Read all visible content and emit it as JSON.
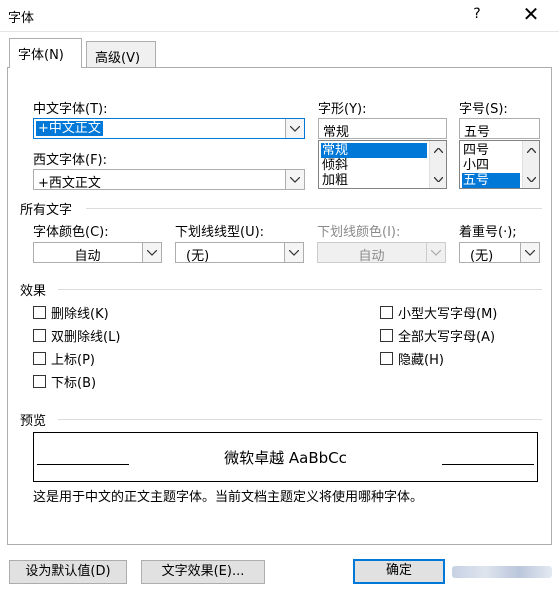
{
  "window": {
    "title": "字体",
    "help": "?",
    "close": "✕"
  },
  "tabs": [
    {
      "label": "字体(N)",
      "active": true
    },
    {
      "label": "高级(V)",
      "active": false
    }
  ],
  "chinese_font": {
    "label": "中文字体(T):",
    "value": "+中文正文"
  },
  "western_font": {
    "label": "西文字体(F):",
    "value": "+西文正文"
  },
  "style": {
    "label": "字形(Y):",
    "value": "常规",
    "options": [
      "常规",
      "倾斜",
      "加粗"
    ],
    "selected": "常规"
  },
  "size": {
    "label": "字号(S):",
    "value": "五号",
    "options": [
      "四号",
      "小四",
      "五号"
    ],
    "selected": "五号"
  },
  "all_text": {
    "section": "所有文字",
    "font_color": {
      "label": "字体颜色(C):",
      "value": "自动"
    },
    "underline_style": {
      "label": "下划线线型(U):",
      "value": "(无)"
    },
    "underline_color": {
      "label": "下划线颜色(I):",
      "value": "自动"
    },
    "emphasis": {
      "label": "着重号(·);",
      "value": "(无)"
    }
  },
  "effects": {
    "section": "效果",
    "left": [
      "删除线(K)",
      "双删除线(L)",
      "上标(P)",
      "下标(B)"
    ],
    "right": [
      "小型大写字母(M)",
      "全部大写字母(A)",
      "隐藏(H)"
    ]
  },
  "preview": {
    "section": "预览",
    "sample": "微软卓越 AaBbCc",
    "description": "这是用于中文的正文主题字体。当前文档主题定义将使用哪种字体。"
  },
  "buttons": {
    "set_default": "设为默认值(D)",
    "text_effects": "文字效果(E)...",
    "ok": "确定"
  }
}
